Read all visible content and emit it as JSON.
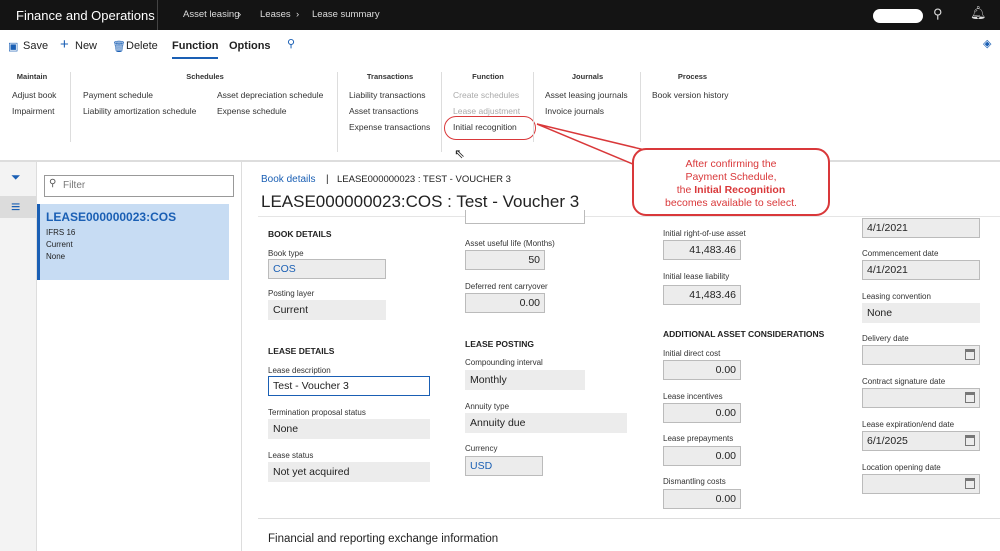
{
  "topbar": {
    "app": "Finance and Operations",
    "breadcrumbs": [
      "Asset leasing",
      "Leases",
      "Lease summary"
    ]
  },
  "actions": {
    "save": "Save",
    "new": "New",
    "delete": "Delete",
    "tab_function": "Function",
    "tab_options": "Options"
  },
  "ribbon": {
    "maintain": {
      "title": "Maintain",
      "items": [
        "Adjust book",
        "Impairment"
      ]
    },
    "schedules": {
      "title": "Schedules",
      "items": [
        "Payment schedule",
        "Liability amortization schedule",
        "Asset depreciation schedule",
        "Expense schedule"
      ]
    },
    "transactions": {
      "title": "Transactions",
      "items": [
        "Liability transactions",
        "Asset transactions",
        "Expense transactions"
      ]
    },
    "function": {
      "title": "Function",
      "items": [
        "Create schedules",
        "Lease adjustment",
        "Initial recognition"
      ]
    },
    "journals": {
      "title": "Journals",
      "items": [
        "Asset leasing journals",
        "Invoice journals"
      ]
    },
    "process": {
      "title": "Process",
      "items": [
        "Book version history"
      ]
    }
  },
  "callout": {
    "line1": "After confirming the",
    "line2": "Payment Schedule,",
    "line3a": "the ",
    "line3b": "Initial Recognition",
    "line4": "becomes available to select."
  },
  "list": {
    "filter_placeholder": "Filter",
    "card": {
      "title": "LEASE000000023:COS",
      "lines": [
        "IFRS 16",
        "Current",
        "None"
      ]
    }
  },
  "main": {
    "breadcrumb_link": "Book details",
    "breadcrumb_sep": "|",
    "breadcrumb_text": "LEASE000000023 : TEST - VOUCHER 3",
    "title": "LEASE000000023:COS : Test - Voucher 3",
    "book_details": "BOOK DETAILS",
    "book_type_label": "Book type",
    "book_type": "COS",
    "posting_layer_label": "Posting layer",
    "posting_layer": "Current",
    "lease_details": "LEASE DETAILS",
    "lease_desc_label": "Lease description",
    "lease_desc": "Test - Voucher 3",
    "term_label": "Termination proposal status",
    "term": "None",
    "status_label": "Lease status",
    "status": "Not yet acquired",
    "useful_life_label": "Asset useful life (Months)",
    "useful_life": "50",
    "deferred_label": "Deferred rent carryover",
    "deferred": "0.00",
    "lease_posting": "LEASE POSTING",
    "compounding_label": "Compounding interval",
    "compounding": "Monthly",
    "annuity_label": "Annuity type",
    "annuity": "Annuity due",
    "currency_label": "Currency",
    "currency": "USD",
    "rou_label": "Initial right-of-use asset",
    "rou": "41,483.46",
    "liab_label": "Initial lease liability",
    "liab": "41,483.46",
    "additional": "ADDITIONAL ASSET CONSIDERATIONS",
    "idc_label": "Initial direct cost",
    "idc": "0.00",
    "incent_label": "Lease incentives",
    "incent": "0.00",
    "prepay_label": "Lease prepayments",
    "prepay": "0.00",
    "dismantle_label": "Dismantling costs",
    "dismantle": "0.00",
    "top_date": "4/1/2021",
    "commence_label": "Commencement date",
    "commence": "4/1/2021",
    "convention_label": "Leasing convention",
    "convention": "None",
    "delivery_label": "Delivery date",
    "contract_label": "Contract signature date",
    "expiry_label": "Lease expiration/end date",
    "expiry": "6/1/2025",
    "location_label": "Location opening date",
    "section_fin": "Financial and reporting exchange information"
  }
}
